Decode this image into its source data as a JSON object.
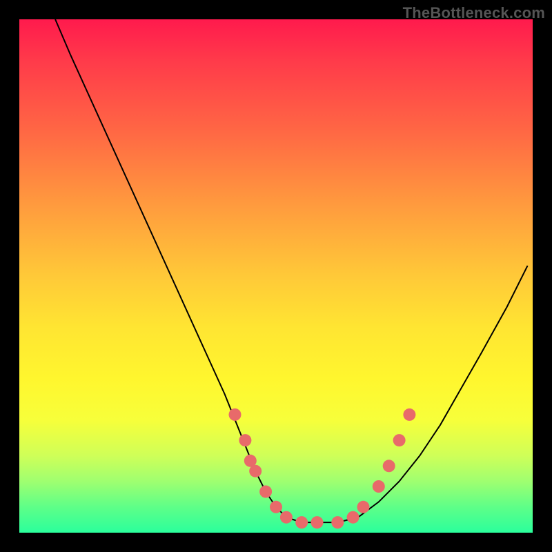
{
  "watermark": "TheBottleneck.com",
  "chart_data": {
    "type": "line",
    "title": "",
    "xlabel": "",
    "ylabel": "",
    "xlim": [
      0,
      100
    ],
    "ylim": [
      0,
      100
    ],
    "grid": false,
    "legend": false,
    "series": [
      {
        "name": "curve",
        "x": [
          7,
          10,
          15,
          20,
          25,
          30,
          35,
          40,
          42,
          44,
          46,
          48,
          50,
          52,
          55,
          58,
          62,
          66,
          70,
          74,
          78,
          82,
          86,
          90,
          95,
          99
        ],
        "y": [
          100,
          93,
          82,
          71,
          60,
          49,
          38,
          27,
          22,
          17,
          12,
          8,
          5,
          3,
          2,
          2,
          2,
          3,
          6,
          10,
          15,
          21,
          28,
          35,
          44,
          52
        ]
      }
    ],
    "markers": [
      {
        "x": 42,
        "y": 23
      },
      {
        "x": 44,
        "y": 18
      },
      {
        "x": 45,
        "y": 14
      },
      {
        "x": 46,
        "y": 12
      },
      {
        "x": 48,
        "y": 8
      },
      {
        "x": 50,
        "y": 5
      },
      {
        "x": 52,
        "y": 3
      },
      {
        "x": 55,
        "y": 2
      },
      {
        "x": 58,
        "y": 2
      },
      {
        "x": 62,
        "y": 2
      },
      {
        "x": 65,
        "y": 3
      },
      {
        "x": 67,
        "y": 5
      },
      {
        "x": 70,
        "y": 9
      },
      {
        "x": 72,
        "y": 13
      },
      {
        "x": 74,
        "y": 18
      },
      {
        "x": 76,
        "y": 23
      }
    ],
    "gradient_meaning": "vertical color gradient from red (top, y≈100) through yellow (middle) to green (bottom, y≈0)"
  }
}
